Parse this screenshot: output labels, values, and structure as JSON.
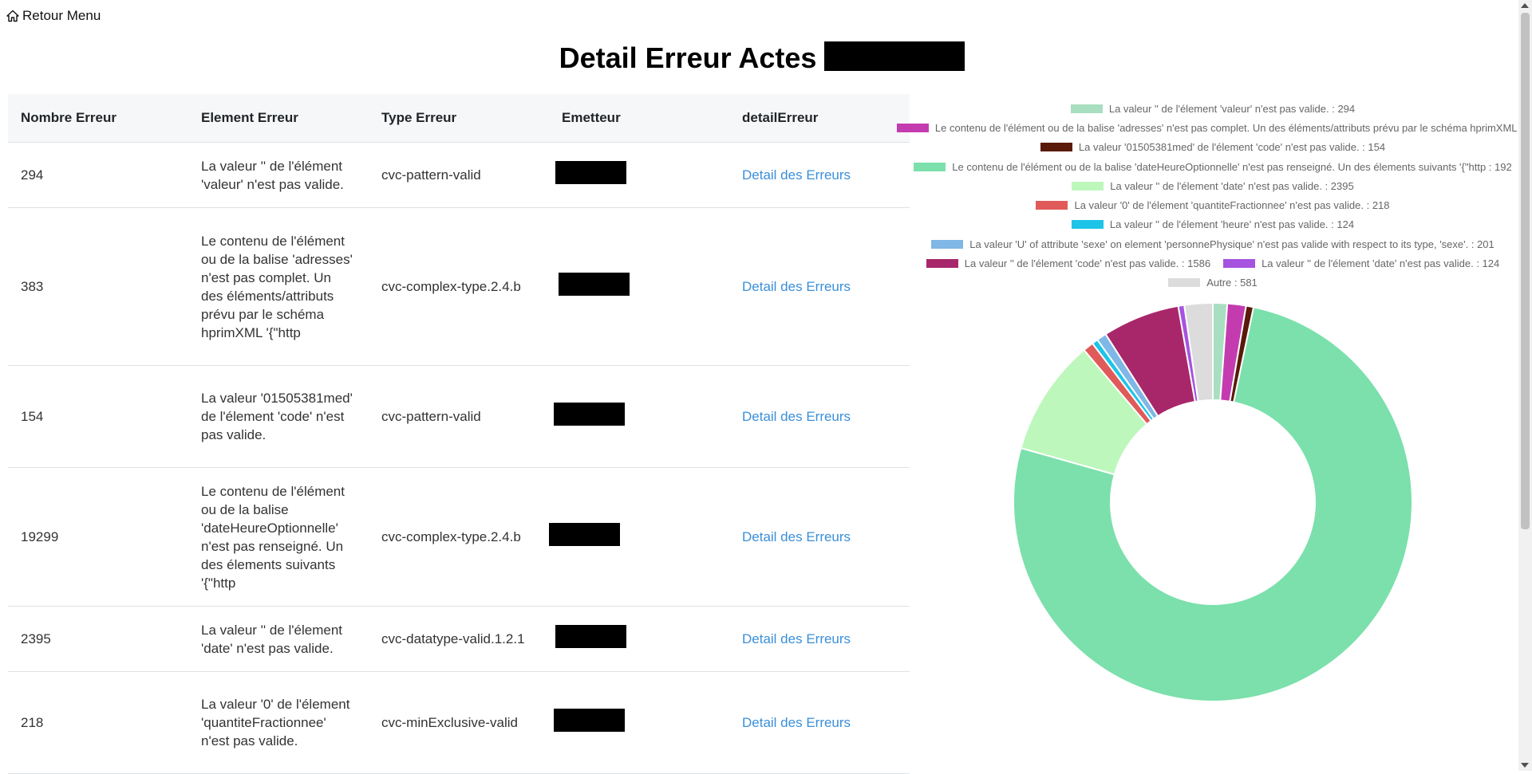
{
  "nav": {
    "back_label": "Retour Menu",
    "back_icon": "home-icon"
  },
  "page": {
    "title": "Detail Erreur Actes"
  },
  "table": {
    "headers": [
      "Nombre Erreur",
      "Element Erreur",
      "Type Erreur",
      "Emetteur",
      "detailErreur"
    ],
    "rows": [
      {
        "count": "294",
        "element": "La valeur '' de l'élément 'valeur' n'est pas valide.",
        "type": "cvc-pattern-valid",
        "link": "Detail des Erreurs"
      },
      {
        "count": "383",
        "element": "Le contenu de l'élément ou de la balise 'adresses' n'est pas complet. Un des éléments/attributs prévu par le schéma hprimXML '{\"http",
        "type": "cvc-complex-type.2.4.b",
        "link": "Detail des Erreurs"
      },
      {
        "count": "154",
        "element": "La valeur '01505381med' de l'élement 'code' n'est pas valide.",
        "type": "cvc-pattern-valid",
        "link": "Detail des Erreurs"
      },
      {
        "count": "19299",
        "element": "Le contenu de l'élément ou de la balise 'dateHeureOptionnelle' n'est pas renseigné. Un des élements suivants '{\"http",
        "type": "cvc-complex-type.2.4.b",
        "link": "Detail des Erreurs"
      },
      {
        "count": "2395",
        "element": "La valeur '' de l'élement 'date' n'est pas valide.",
        "type": "cvc-datatype-valid.1.2.1",
        "link": "Detail des Erreurs"
      },
      {
        "count": "218",
        "element": "La valeur '0' de l'élement 'quantiteFractionnee' n'est pas valide.",
        "type": "cvc-minExclusive-valid",
        "link": "Detail des Erreurs"
      }
    ]
  },
  "chart_data": {
    "type": "pie",
    "variant": "doughnut",
    "legend_position": "top",
    "labels": [
      "La valeur '' de l'élement 'valeur' n'est pas valide. : 294",
      "Le contenu de l'élément ou de la balise 'adresses' n'est pas complet. Un des éléments/attributs prévu par le schéma hprimXML '{\"",
      "La valeur '01505381med' de l'élement 'code' n'est pas valide. : 154",
      "Le contenu de l'élément ou de la balise 'dateHeureOptionnelle' n'est pas renseigné. Un des élements suivants  '{\"http : 192",
      "La valeur '' de l'élement 'date' n'est pas valide. : 2395",
      "La valeur '0' de l'élement 'quantiteFractionnee' n'est pas valide. : 218",
      "La valeur '' de l'élement 'heure' n'est pas valide. : 124",
      "La valeur 'U' of attribute 'sexe' on element 'personnePhysique' n'est pas valide with respect to its type, 'sexe'. : 201",
      "La valeur '' de l'élement 'code' n'est pas valide. : 1586",
      "La valeur '' de l'élement 'date' n'est pas valide. : 124",
      "Autre : 581"
    ],
    "values": [
      294,
      383,
      154,
      19299,
      2395,
      218,
      124,
      201,
      1586,
      124,
      581
    ],
    "colors": [
      "#a8dfc0",
      "#c43bb0",
      "#5a1a0a",
      "#7be0ab",
      "#bdf7bc",
      "#e05a5a",
      "#1ec4e8",
      "#7fb7e6",
      "#a8276a",
      "#a653e0",
      "#dcdcdc"
    ]
  }
}
